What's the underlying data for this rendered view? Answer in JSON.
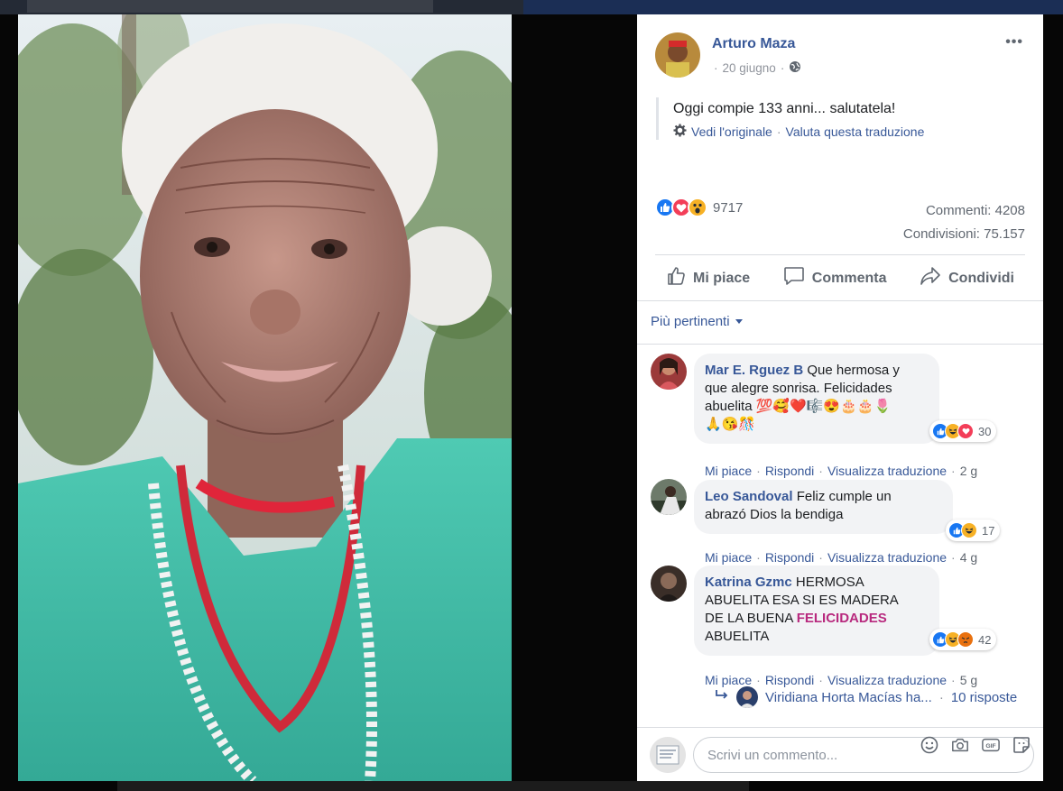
{
  "post": {
    "author": "Arturo Maza",
    "date": "20 giugno",
    "separator": "·",
    "more_label": "•••",
    "text": "Oggi compie 133 anni... salutatela!",
    "see_original": "Vedi l'originale",
    "rate_translation": "Valuta questa traduzione",
    "reactions_count": "9717",
    "comments_count": "Commenti: 4208",
    "shares_count": "Condivisioni: 75.157"
  },
  "actions": {
    "like": "Mi piace",
    "comment": "Commenta",
    "share": "Condividi"
  },
  "sort_label": "Più pertinenti",
  "comments": [
    {
      "name": "Mar E. Rguez B",
      "text_line1": " Que hermosa y",
      "text_line2": "que alegre sonrisa. Felicidades",
      "text_line3": "abuelita 💯🥰❤️🎼😍🎂🎂🌷",
      "text_line4": "🙏😘🎊",
      "reactions": "30",
      "like": "Mi piace",
      "reply": "Rispondi",
      "translate": "Visualizza traduzione",
      "time": "2 g"
    },
    {
      "name": "Leo Sandoval",
      "text_line1": " Feliz cumple un",
      "text_line2": "abrazó Dios la bendiga",
      "reactions": "17",
      "like": "Mi piace",
      "reply": "Rispondi",
      "translate": "Visualizza traduzione",
      "time": "4 g"
    },
    {
      "name": "Katrina Gzmc",
      "text_line1": " HERMOSA",
      "text_line2": "ABUELITA ESA SI ES MADERA",
      "text_line3_pre": "DE LA BUENA ",
      "text_line3_hl": "FELICIDADES",
      "text_line4": "ABUELITA",
      "reactions": "42",
      "like": "Mi piace",
      "reply": "Rispondi",
      "translate": "Visualizza traduzione",
      "time": "5 g"
    }
  ],
  "replies_row": {
    "name": "Viridiana Horta Macías ha...",
    "count": "10 risposte"
  },
  "composer": {
    "placeholder": "Scrivi un commento...",
    "gif_label": "GIF"
  },
  "colors": {
    "link_blue": "#385898",
    "like_blue": "#1877f2",
    "love_red": "#f33e58",
    "wow_yellow": "#f7b125",
    "highlight_magenta": "#b8297e",
    "overlay_bg": "#060606"
  },
  "icons": [
    "globe-icon",
    "gear-icon",
    "like-icon",
    "love-icon",
    "wow-icon",
    "haha-icon",
    "angry-icon",
    "thumbs-up-icon",
    "comment-icon",
    "share-icon",
    "reply-arrow-icon",
    "emoji-icon",
    "camera-icon",
    "gif-icon",
    "sticker-icon"
  ]
}
